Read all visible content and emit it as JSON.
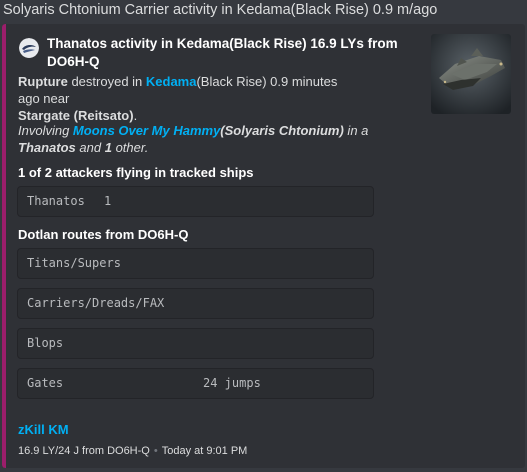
{
  "message": {
    "text": "Solyaris Chtonium Carrier activity in Kedama(Black Rise) 0.9 m/ago"
  },
  "embed": {
    "accent_color": "#9b1e6b",
    "author": {
      "icon": "corp-logo-icon",
      "name": "Thanatos activity in Kedama(Black Rise) 16.9 LYs from DO6H-Q"
    },
    "thumbnail": "ship-thanatos-thumbnail",
    "description": {
      "victim_ship": "Rupture",
      "destroyed_in": " destroyed in ",
      "system": "Kedama",
      "region": "(Black Rise) 0.9 minutes ago near",
      "location": "Stargate (Reitsato)",
      "location_end": ".",
      "involving": "Involving ",
      "attacker_name": "Moons Over My Hammy",
      "attacker_corp": "(Solyaris Chtonium)",
      "in_a": " in a",
      "attacker_ship": "Thanatos",
      "and": " and ",
      "others_count": "1",
      "other": " other."
    },
    "fields": {
      "attackers_title": "1 of 2 attackers flying in tracked ships",
      "attackers_ship": "Thanatos",
      "attackers_count": "1",
      "routes_title": "Dotlan routes from DO6H-Q",
      "route_titans": "Titans/Supers",
      "route_carriers": "Carriers/Dreads/FAX",
      "route_blops": "Blops",
      "route_gates": "Gates",
      "route_gates_value": "24 jumps"
    },
    "link": "zKill KM",
    "footer": {
      "info": "16.9 LY/24 J from DO6H-Q",
      "separator": "•",
      "timestamp": "Today at 9:01 PM"
    }
  }
}
